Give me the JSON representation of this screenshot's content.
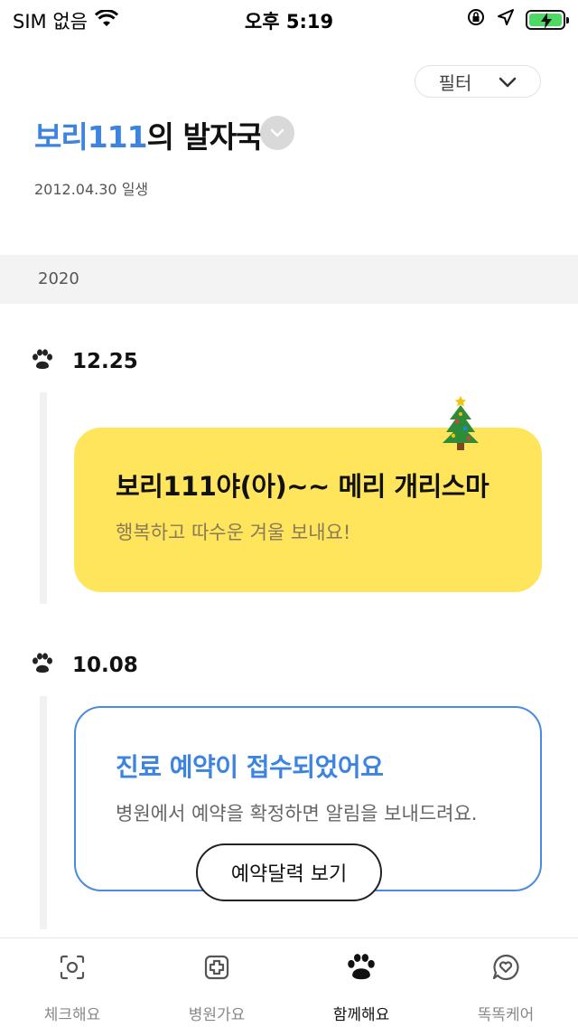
{
  "status_bar": {
    "carrier": "SIM 없음",
    "time": "오후 5:19"
  },
  "header": {
    "filter_label": "필터",
    "pet_name": "보리111",
    "title_suffix": "의 발자국",
    "birth_date": "2012.04.30 일생"
  },
  "timeline": {
    "year": "2020",
    "entries": [
      {
        "date": "12.25",
        "title": "보리111야(아)~~ 메리 개리스마",
        "subtitle": "행복하고 따수운 겨울 보내요!",
        "icon": "christmas-tree-icon",
        "card_color": "#ffe55c"
      },
      {
        "date": "10.08",
        "title": "진료 예약이 접수되었어요",
        "subtitle": "병원에서 예약을 확정하면 알림을 보내드려요.",
        "button_label": "예약달력 보기",
        "card_color": "#4a8be0"
      }
    ]
  },
  "bottom_nav": {
    "items": [
      {
        "label": "체크해요",
        "icon": "camera-scan-icon"
      },
      {
        "label": "병원가요",
        "icon": "hospital-cross-icon"
      },
      {
        "label": "함께해요",
        "icon": "paw-icon",
        "active": true
      },
      {
        "label": "똑똑케어",
        "icon": "heart-chat-icon"
      }
    ]
  },
  "colors": {
    "accent": "#3c84e0",
    "highlight_card": "#ffe55c",
    "active_nav": "#111111"
  }
}
